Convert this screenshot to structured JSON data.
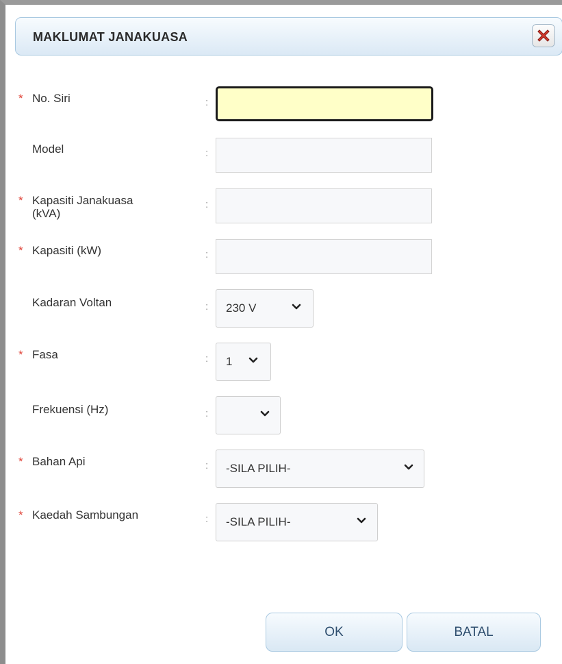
{
  "dialog": {
    "title": "MAKLUMAT JANAKUASA",
    "close_icon": "close-red-x-icon"
  },
  "form": {
    "required_mark": "*",
    "separator": ":",
    "no_siri": {
      "label": "No. Siri",
      "required": true,
      "value": ""
    },
    "model": {
      "label": "Model",
      "required": false,
      "value": ""
    },
    "kapasiti_kva": {
      "label_line1": "Kapasiti Janakuasa",
      "label_line2": "(kVA)",
      "required": true,
      "value": ""
    },
    "kapasiti_kw": {
      "label": "Kapasiti (kW)",
      "required": true,
      "value": ""
    },
    "kadaran_voltan": {
      "label": "Kadaran Voltan",
      "required": false,
      "selected": "230 V"
    },
    "fasa": {
      "label": "Fasa",
      "required": true,
      "selected": "1"
    },
    "frekuensi": {
      "label": "Frekuensi (Hz)",
      "required": false,
      "selected": ""
    },
    "bahan_api": {
      "label": "Bahan Api",
      "required": true,
      "selected": "-SILA PILIH-"
    },
    "kaedah_sambungan": {
      "label": "Kaedah Sambungan",
      "required": true,
      "selected": "-SILA PILIH-"
    }
  },
  "buttons": {
    "ok": "OK",
    "cancel": "BATAL"
  },
  "colors": {
    "required": "#e0453a",
    "active_field_bg": "#ffffc8",
    "titlebar_border": "#a9c9e1",
    "close_icon": "#d83a2e"
  }
}
